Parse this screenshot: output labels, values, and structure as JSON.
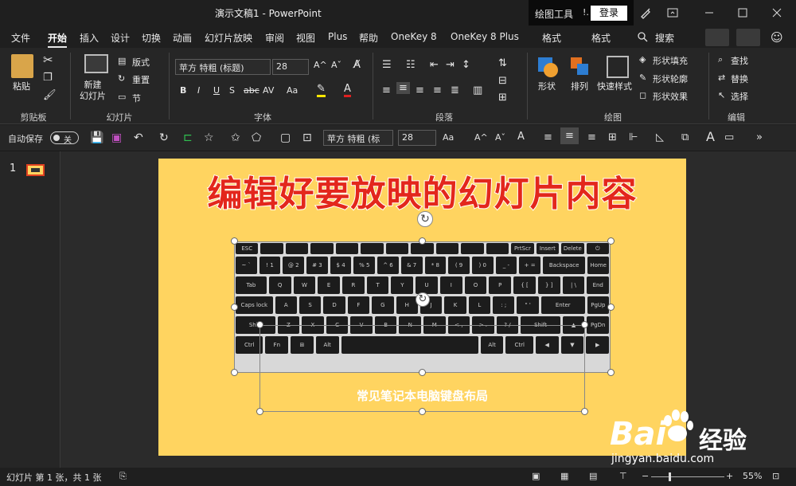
{
  "window": {
    "title": "演示文稿1  -  PowerPoint",
    "contextual_tab": "绘图工具",
    "context_marker": "!.",
    "login_label": "登录"
  },
  "menu": {
    "items": [
      "文件",
      "开始",
      "插入",
      "设计",
      "切换",
      "动画",
      "幻灯片放映",
      "审阅",
      "视图",
      "Plus",
      "帮助",
      "OneKey 8",
      "OneKey 8 Plus",
      "格式",
      "格式"
    ],
    "active": "开始",
    "search_label": "搜索"
  },
  "ribbon": {
    "clipboard": {
      "paste_label": "粘贴",
      "group_label": "剪贴板"
    },
    "slides": {
      "new_slide_label": "新建\n幻灯片",
      "layout_label": "版式",
      "reset_label": "重置",
      "section_label": "节",
      "group_label": "幻灯片"
    },
    "font": {
      "font_name": "苹方 特粗 (标题)",
      "font_size": "28",
      "group_label": "字体"
    },
    "paragraph": {
      "group_label": "段落"
    },
    "drawing": {
      "shapes_label": "形状",
      "arrange_label": "排列",
      "quick_styles_label": "快速样式",
      "fill_label": "形状填充",
      "outline_label": "形状轮廓",
      "effects_label": "形状效果",
      "group_label": "绘图"
    },
    "editing": {
      "find_label": "查找",
      "replace_label": "替换",
      "select_label": "选择",
      "group_label": "编辑"
    }
  },
  "qat": {
    "autosave_label": "自动保存",
    "autosave_state": "关",
    "font_name": "苹方 特粗 (标",
    "font_size": "28"
  },
  "thumbnails": {
    "slide_number": "1"
  },
  "slide": {
    "heading": "编辑好要放映的幻灯片内容",
    "caption": "常见笔记本电脑键盘布局",
    "background_color": "#ffd460"
  },
  "keyboard": {
    "rows": [
      [
        "ESC",
        "",
        "",
        "",
        "",
        "",
        "",
        "",
        "",
        "",
        "",
        "PrtScr",
        "Insert",
        "Delete",
        "⏻"
      ],
      [
        "~ `",
        "! 1",
        "@ 2",
        "# 3",
        "$ 4",
        "% 5",
        "^ 6",
        "& 7",
        "* 8",
        "( 9",
        ") 0",
        "_ -",
        "+ =",
        "Backspace",
        "Home"
      ],
      [
        "Tab",
        "Q",
        "W",
        "E",
        "R",
        "T",
        "Y",
        "U",
        "I",
        "O",
        "P",
        "{ [",
        "} ]",
        "| \\",
        "End"
      ],
      [
        "Caps lock",
        "A",
        "S",
        "D",
        "F",
        "G",
        "H",
        "J",
        "K",
        "L",
        ": ;",
        "\" '",
        "Enter",
        "PgUp"
      ],
      [
        "Shift",
        "Z",
        "X",
        "C",
        "V",
        "B",
        "N",
        "M",
        "< ,",
        "> .",
        "? /",
        "Shift",
        "▲",
        "PgDn"
      ],
      [
        "Ctrl",
        "Fn",
        "⊞",
        "Alt",
        "",
        "Alt",
        "Ctrl",
        "◀",
        "▼",
        "▶"
      ]
    ]
  },
  "status": {
    "slide_info": "幻灯片 第 1 张，共 1 张",
    "zoom": "55%"
  },
  "watermark": {
    "brand": "Bai",
    "brand_cn": "经验",
    "url": "jingyan.baidu.com"
  }
}
